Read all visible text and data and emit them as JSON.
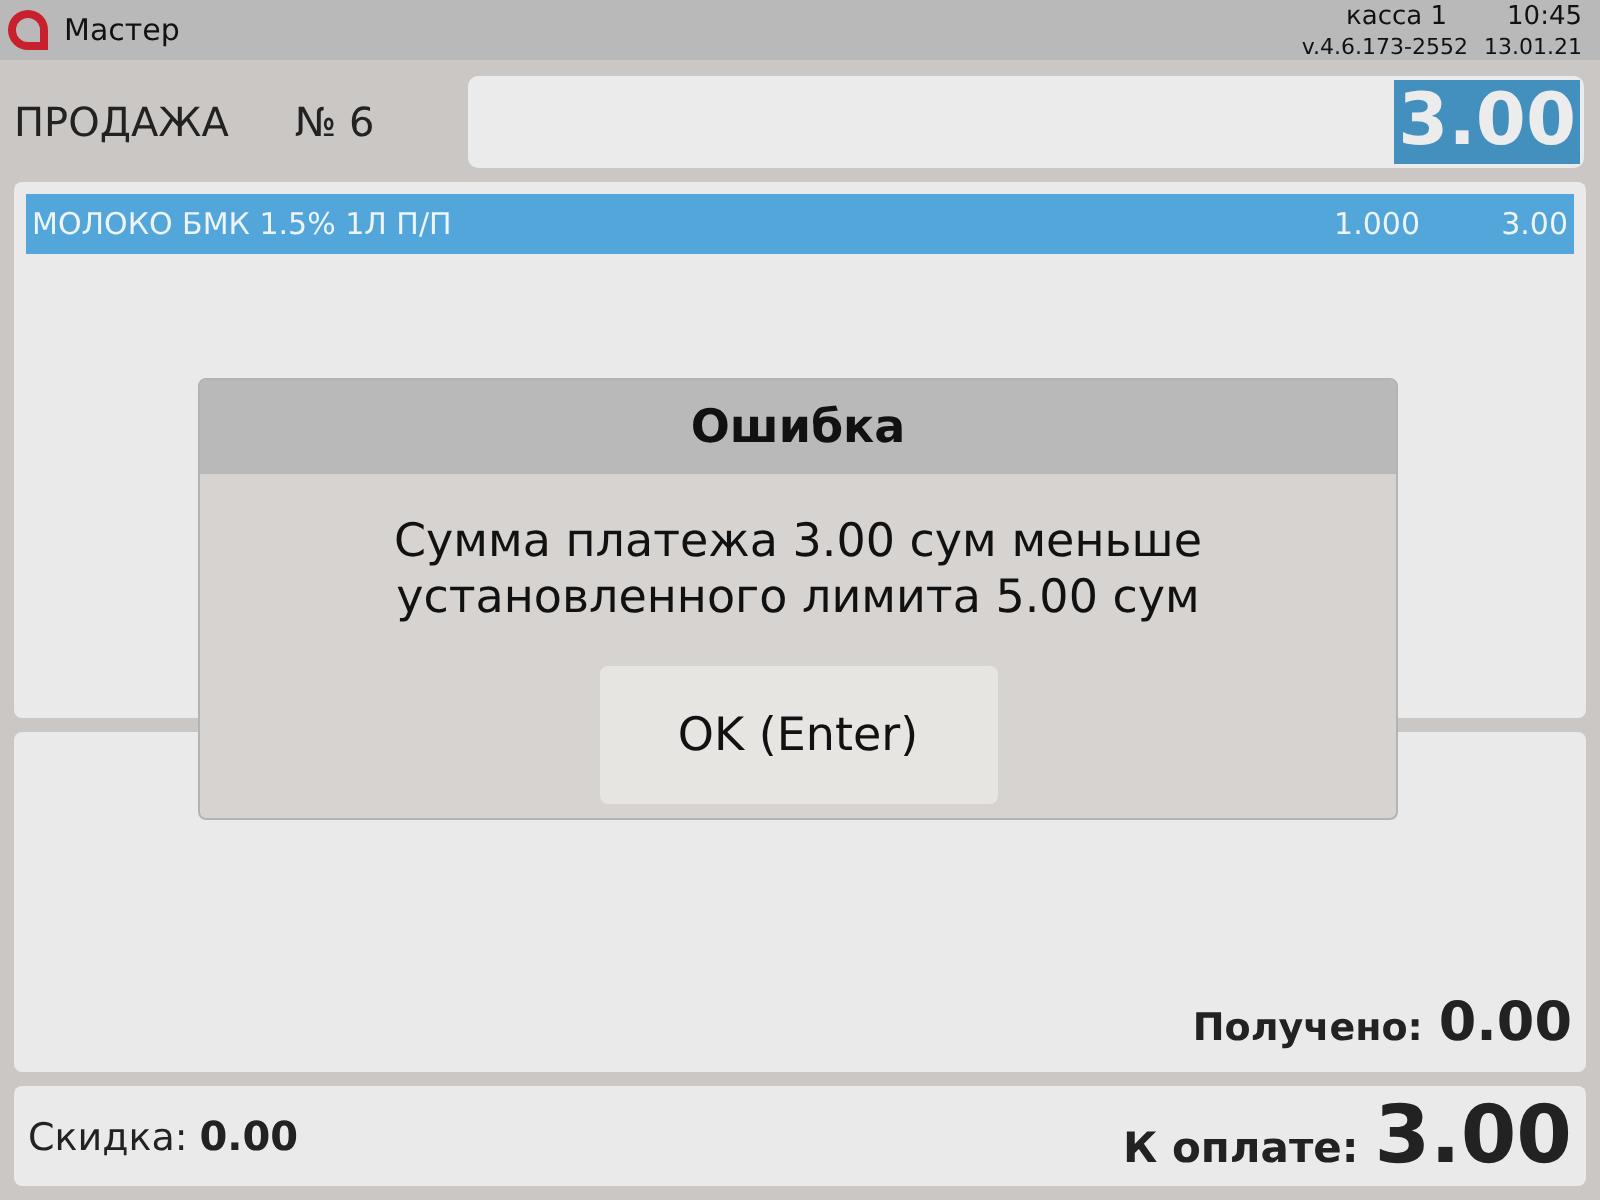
{
  "title_bar": {
    "app_name": "Мастер",
    "register": "касса 1",
    "time": "10:45",
    "version": "v.4.6.173-2552",
    "date": "13.01.21"
  },
  "sale": {
    "title": "ПРОДАЖА",
    "number": "№ 6"
  },
  "amount_field": {
    "value": "3.00",
    "value_selected": true
  },
  "items": [
    {
      "name": "МОЛОКО БМК 1.5% 1Л П/П",
      "quantity": "1.000",
      "sum": "3.00",
      "selected": true
    }
  ],
  "payment": {
    "received_label": "Получено:",
    "received": "0.00"
  },
  "footer": {
    "discount_label": "Скидка:",
    "discount": "0.00",
    "total_label": "К оплате:",
    "total": "3.00"
  },
  "dialog": {
    "title": "Ошибка",
    "message": "Сумма платежа 3.00 сум меньше установленного лимита 5.00 сум",
    "buttons": [
      "OK (Enter)"
    ]
  }
}
